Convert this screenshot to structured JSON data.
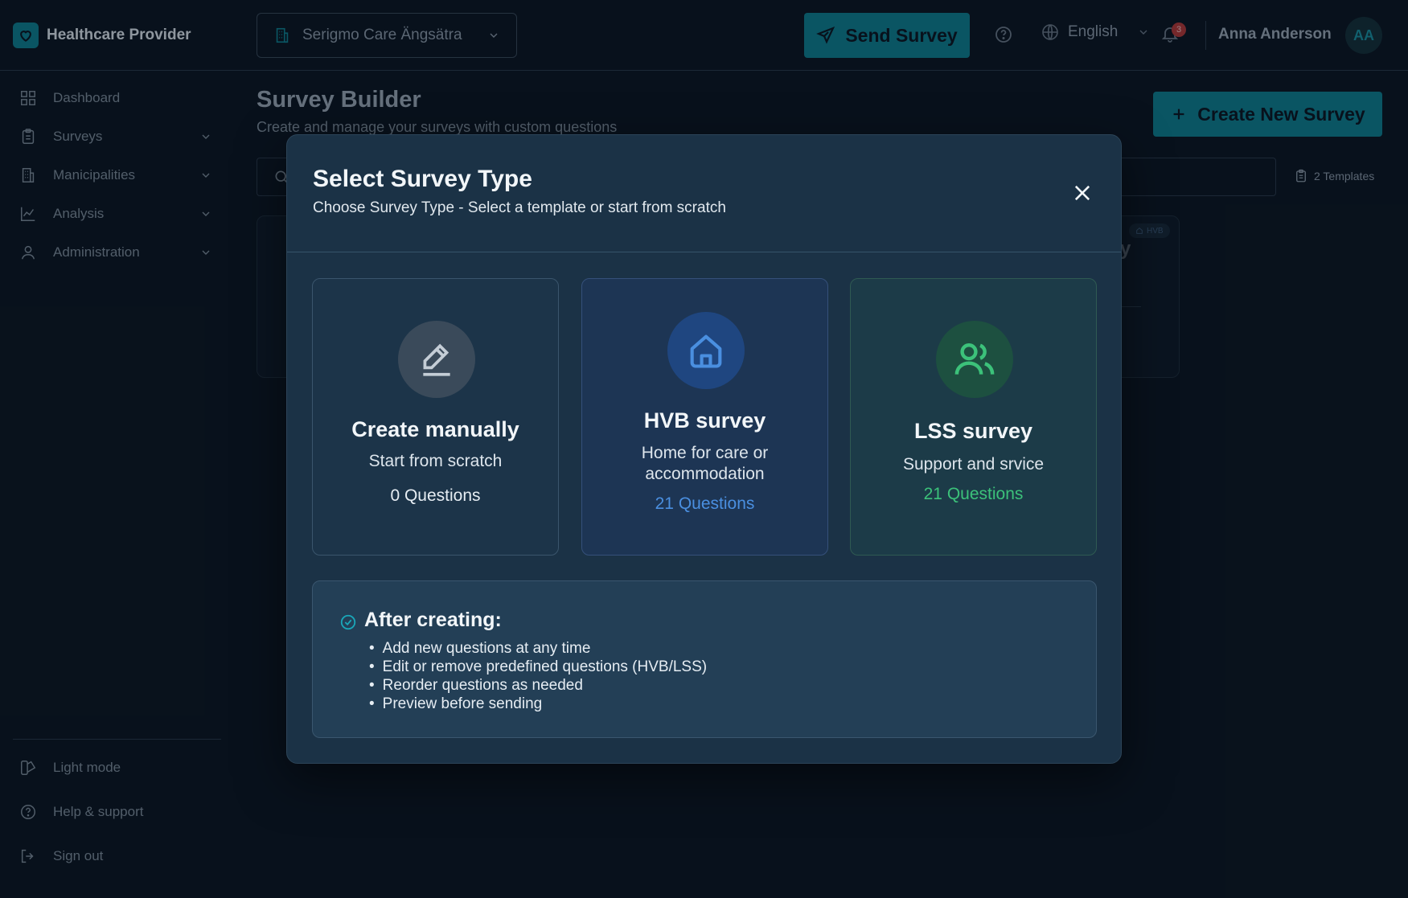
{
  "header": {
    "brand": "Healthcare Provider",
    "facility": "Serigmo Care Ängsätra",
    "send_survey": "Send Survey",
    "language": "English",
    "notification_count": "3",
    "user_name": "Anna Anderson",
    "user_initials": "AA"
  },
  "sidebar": {
    "items": [
      {
        "label": "Dashboard",
        "icon": "grid-icon"
      },
      {
        "label": "Surveys",
        "icon": "clipboard-icon"
      },
      {
        "label": "Manicipalities",
        "icon": "building-icon"
      },
      {
        "label": "Analysis",
        "icon": "chart-line-icon"
      },
      {
        "label": "Administration",
        "icon": "user-icon"
      }
    ],
    "footer": {
      "light_mode": "Light mode",
      "help": "Help & support",
      "sign_out": "Sign out"
    }
  },
  "page": {
    "title": "Survey Builder",
    "subtitle": "Create and manage your surveys with custom questions",
    "create_button": "Create New Survey",
    "templates_count": "2 Templates",
    "bg_badge": "HVB",
    "bg_text": "y"
  },
  "modal": {
    "title": "Select Survey Type",
    "subtitle": "Choose Survey Type - Select a template or start from scratch",
    "cards": {
      "manual": {
        "title": "Create manually",
        "desc": "Start from scratch",
        "count": "0 Questions"
      },
      "hvb": {
        "title": "HVB survey",
        "desc": "Home for care or accommodation",
        "count": "21 Questions"
      },
      "lss": {
        "title": "LSS survey",
        "desc": "Support and srvice",
        "count": "21 Questions"
      }
    },
    "after": {
      "title": "After creating:",
      "items": [
        "Add new questions at any time",
        "Edit or remove predefined questions (HVB/LSS)",
        "Reorder questions as needed",
        "Preview before sending"
      ]
    }
  },
  "colors": {
    "accent": "#0e7f8f",
    "hvb_blue": "#4a8fe0",
    "lss_green": "#3cc27a"
  }
}
